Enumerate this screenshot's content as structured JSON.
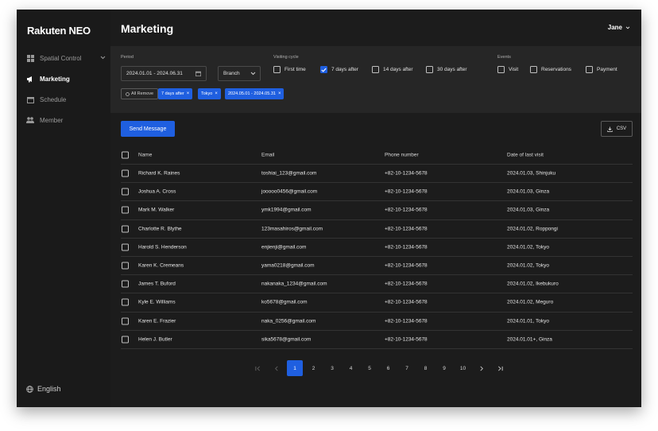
{
  "app": {
    "logo": "Rakuten NEO"
  },
  "sidebar": {
    "items": [
      {
        "label": "Spatial Control",
        "icon": "grid-icon"
      },
      {
        "label": "Marketing",
        "icon": "megaphone-icon"
      },
      {
        "label": "Schedule",
        "icon": "calendar-icon"
      },
      {
        "label": "Member",
        "icon": "users-icon"
      }
    ],
    "language": "English"
  },
  "header": {
    "title": "Marketing",
    "user": "Jane"
  },
  "filters": {
    "period_label": "Period",
    "period_value": "2024.01.01 - 2024.06.31",
    "branch": "Branch",
    "visiting_label": "Visiting cycle",
    "visiting_options": [
      {
        "label": "First time",
        "checked": false
      },
      {
        "label": "7 days after",
        "checked": true
      },
      {
        "label": "14 days after",
        "checked": false
      },
      {
        "label": "30 days after",
        "checked": false
      }
    ],
    "events_label": "Events",
    "event_options": [
      {
        "label": "Visit",
        "checked": false
      },
      {
        "label": "Reservations",
        "checked": false
      },
      {
        "label": "Payment",
        "checked": false
      }
    ],
    "remove_all": "All Remove",
    "chips": [
      "7 days after",
      "Tokyo",
      "2024.05.01 - 2024.05.31"
    ]
  },
  "actions": {
    "send": "Send Message",
    "csv": "CSV"
  },
  "table": {
    "headers": {
      "name": "Name",
      "email": "Email",
      "phone": "Phone number",
      "date": "Date of last visit"
    },
    "rows": [
      {
        "name": "Richard K. Raines",
        "email": "toshiai_123@gmail.com",
        "phone": "+82-10-1234-5678",
        "date": "2024.01.03, Shinjuku"
      },
      {
        "name": "Joshua A. Cross",
        "email": "jooooo0456@gmail.com",
        "phone": "+82-10-1234-5678",
        "date": "2024.01.03, Ginza"
      },
      {
        "name": "Mark M. Walker",
        "email": "ymk1994@gmail.com",
        "phone": "+82-10-1234-5678",
        "date": "2024.01.03, Ginza"
      },
      {
        "name": "Charlotte R. Blythe",
        "email": "123masahiros@gmail.com",
        "phone": "+82-10-1234-5678",
        "date": "2024.01.02, Roppongi"
      },
      {
        "name": "Harold S. Henderson",
        "email": "enjienji@gmail.com",
        "phone": "+82-10-1234-5678",
        "date": "2024.01.02, Tokyo"
      },
      {
        "name": "Karen K. Cremeans",
        "email": "yama0218@gmail.com",
        "phone": "+82-10-1234-5678",
        "date": "2024.01.02, Tokyo"
      },
      {
        "name": "James T. Buford",
        "email": "nakanaka_1234@gmail.com",
        "phone": "+82-10-1234-5678",
        "date": "2024.01.02, Ikebukuro"
      },
      {
        "name": "Kyle E. Williams",
        "email": "ko5678@gmail.com",
        "phone": "+82-10-1234-5678",
        "date": "2024.01.02, Meguro"
      },
      {
        "name": "Karen E. Frazier",
        "email": "naka_0256@gmail.com",
        "phone": "+82-10-1234-5678",
        "date": "2024.01.01, Tokyo"
      },
      {
        "name": "Helen J. Butler",
        "email": "sika5678@gmail.com",
        "phone": "+82-10-1234-5678",
        "date": "2024.01.01+, Ginza"
      }
    ]
  },
  "pagination": {
    "pages": [
      "1",
      "2",
      "3",
      "4",
      "5",
      "6",
      "7",
      "8",
      "9",
      "10"
    ],
    "current": "1"
  },
  "colors": {
    "accent": "#1f5fe0",
    "background": "#1c1c1c",
    "panel": "#262626"
  }
}
